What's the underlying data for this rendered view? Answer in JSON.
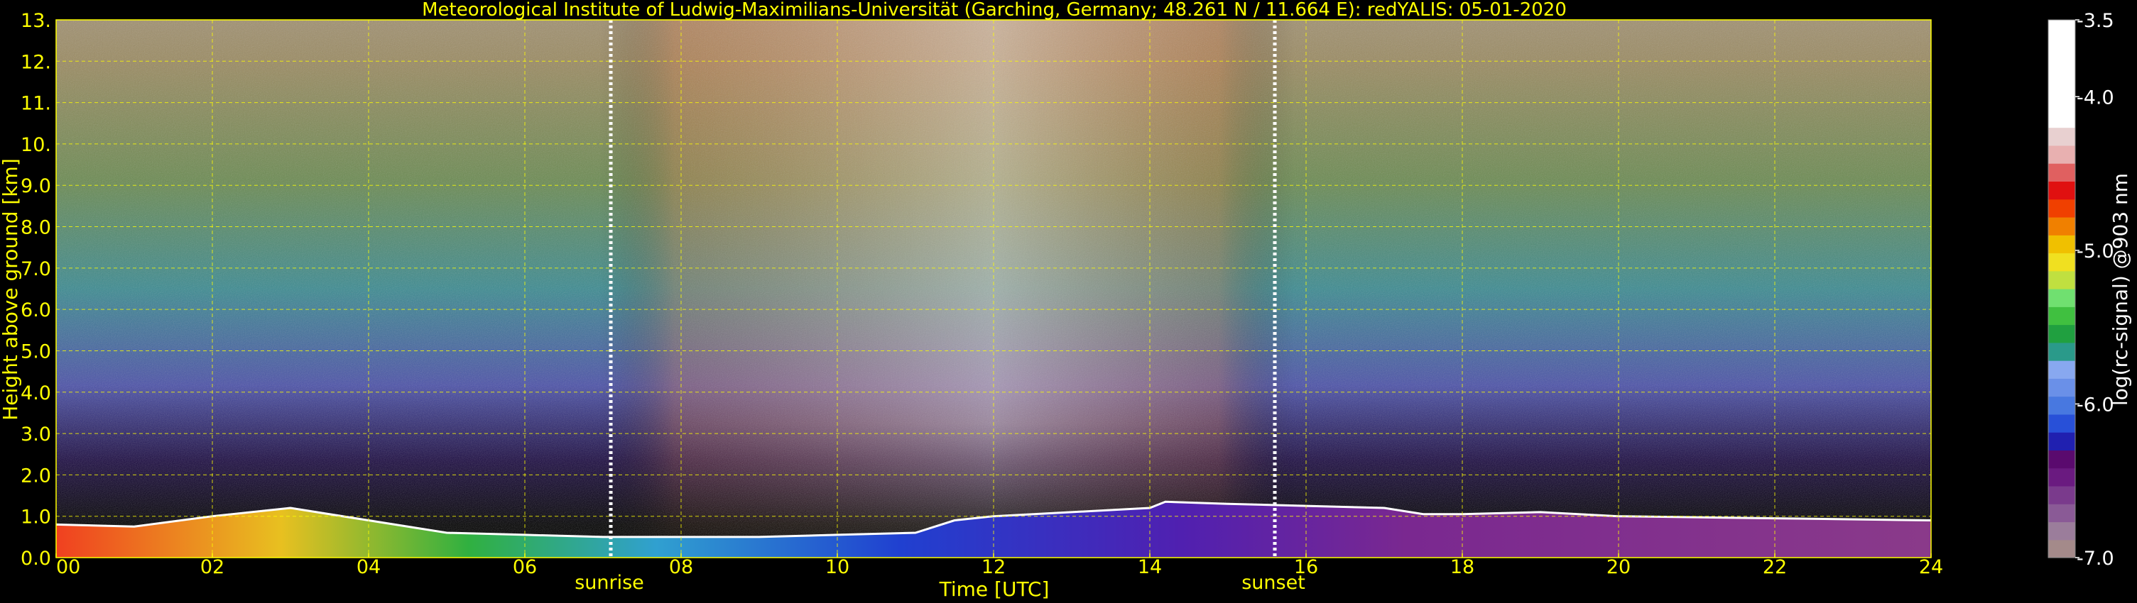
{
  "chart_data": {
    "type": "heatmap",
    "title": "Meteorological Institute of Ludwig-Maximilians-Universität (Garching, Germany; 48.261 N / 11.664 E):    redYALIS: 05-01-2020",
    "xlabel": "Time [UTC]",
    "ylabel": "Height above ground [km]",
    "xlim": [
      0,
      24
    ],
    "ylim": [
      0,
      13
    ],
    "x_ticks": [
      "00",
      "02",
      "04",
      "06",
      "08",
      "10",
      "12",
      "14",
      "16",
      "18",
      "20",
      "22",
      "24"
    ],
    "y_ticks": [
      "0.0",
      "1.0",
      "2.0",
      "3.0",
      "4.0",
      "5.0",
      "6.0",
      "7.0",
      "8.0",
      "9.0",
      "10.",
      "11.",
      "12.",
      "13."
    ],
    "grid": true,
    "grid_color": "#ffff00",
    "text_color": "#ffff00",
    "annotations": [
      {
        "label": "sunrise",
        "x": 7.1
      },
      {
        "label": "sunset",
        "x": 15.6
      }
    ],
    "colorbar": {
      "label": "log(rc-signal) @903 nm",
      "range": [
        -7.0,
        -3.5
      ],
      "ticks": [
        "-3.5",
        "-4.0",
        "-5.0",
        "-6.0",
        "-7.0"
      ],
      "colors": [
        "#a48a8a",
        "#9b7d9b",
        "#8a5a96",
        "#7a3a8c",
        "#6a1a80",
        "#5a0a6e",
        "#2020b0",
        "#2850d8",
        "#4878e0",
        "#6a90e8",
        "#88a8f0",
        "#2a9a8a",
        "#20a040",
        "#40c040",
        "#70e070",
        "#c0e040",
        "#f0e020",
        "#f0c000",
        "#f08000",
        "#f04000",
        "#e01010",
        "#e06060",
        "#e8b0b0",
        "#e8d0d0",
        "#ffffff"
      ]
    },
    "aerosol_layer_top_km": {
      "x": [
        0,
        1,
        2,
        3,
        4,
        5,
        6,
        7,
        8,
        9,
        10,
        11,
        11.5,
        12,
        13,
        14,
        14.2,
        15,
        16,
        17,
        17.5,
        18,
        19,
        20,
        22,
        24
      ],
      "values": [
        0.8,
        0.75,
        1.0,
        1.2,
        0.9,
        0.6,
        0.55,
        0.5,
        0.5,
        0.5,
        0.55,
        0.6,
        0.9,
        1.0,
        1.1,
        1.2,
        1.35,
        1.3,
        1.25,
        1.2,
        1.05,
        1.05,
        1.1,
        1.0,
        0.95,
        0.9
      ]
    }
  }
}
